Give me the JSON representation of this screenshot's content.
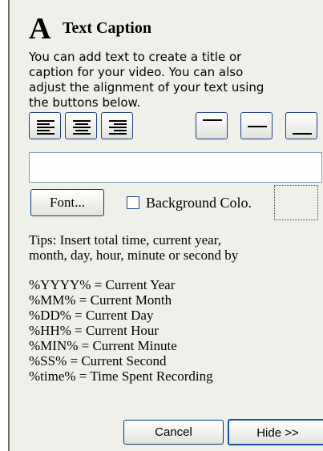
{
  "panel": {
    "icon_glyph": "A",
    "title": "Text Caption",
    "description_lines": [
      "You can add text to create a title or",
      "caption for your video. You can also",
      "adjust the alignment of your text using",
      "the buttons below."
    ]
  },
  "alignment_buttons": [
    "align-left-icon",
    "align-center-icon",
    "align-right-icon",
    "position-top-icon",
    "position-middle-icon",
    "position-bottom-icon"
  ],
  "caption_input": {
    "value": "",
    "placeholder": ""
  },
  "font_button": {
    "label": "Font..."
  },
  "background_color": {
    "label": "Background Colo.",
    "checked": false
  },
  "tips": {
    "lines": [
      "Tips: Insert total time, current year,",
      "month, day, hour, minute or second by"
    ],
    "codes": [
      "%YYYY% = Current Year",
      "%MM% = Current Month",
      "%DD% = Current Day",
      "%HH% = Current Hour",
      "%MIN% = Current Minute",
      "%SS% = Current Second",
      "%time% = Time Spent Recording"
    ]
  },
  "buttons": {
    "cancel": "Cancel",
    "hide": "Hide >>"
  }
}
